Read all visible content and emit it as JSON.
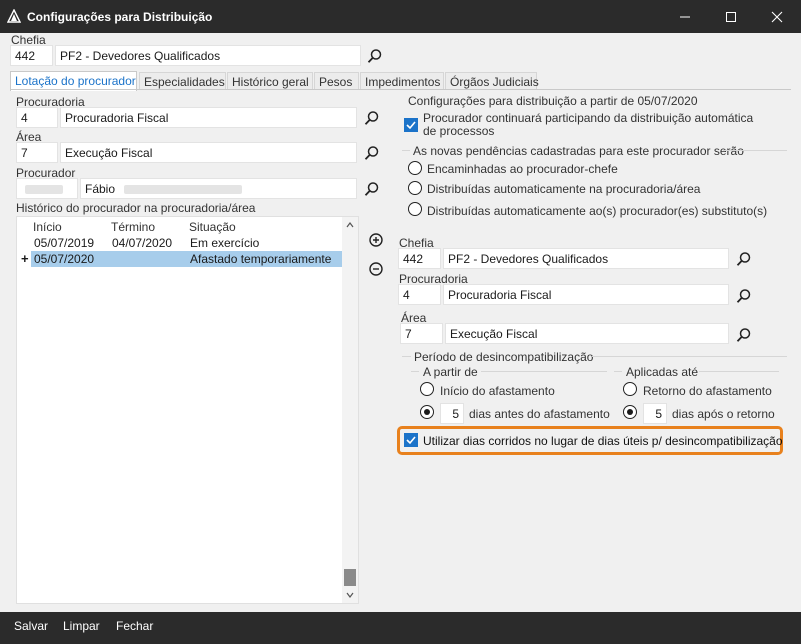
{
  "window": {
    "title": "Configurações para Distribuição",
    "minimize_icon": "minimize-icon",
    "maximize_icon": "maximize-icon",
    "close_icon": "close-icon"
  },
  "top": {
    "chefia_label": "Chefia",
    "chefia_code": "442",
    "chefia_name": "PF2 - Devedores Qualificados"
  },
  "tabs": [
    {
      "label": "Lotação do procurador",
      "active": true
    },
    {
      "label": "Especialidades"
    },
    {
      "label": "Histórico geral"
    },
    {
      "label": "Pesos"
    },
    {
      "label": "Impedimentos"
    },
    {
      "label": "Órgãos Judiciais"
    }
  ],
  "left": {
    "procuradoria_label": "Procuradoria",
    "procuradoria_code": "4",
    "procuradoria_name": "Procuradoria Fiscal",
    "area_label": "Área",
    "area_code": "7",
    "area_name": "Execução Fiscal",
    "procurador_label": "Procurador",
    "procurador_name": "Fábio",
    "historico_label": "Histórico do procurador na procuradoria/área",
    "columns": [
      "Início",
      "Término",
      "Situação"
    ],
    "rows": [
      {
        "inicio": "05/07/2019",
        "termino": "04/07/2020",
        "situacao": "Em exercício"
      },
      {
        "marker": "+",
        "inicio": "05/07/2020",
        "termino": "",
        "situacao": "Afastado temporariamente"
      }
    ]
  },
  "right": {
    "config_title": "Configurações para distribuição a partir de 05/07/2020",
    "continue_label": "Procurador continuará participando da distribuição automática de processos",
    "pendencias_label": "As novas pendências cadastradas para este procurador serão",
    "pend_options": [
      "Encaminhadas ao procurador-chefe",
      "Distribuídas automaticamente na procuradoria/área",
      "Distribuídas automaticamente ao(s) procurador(es) substituto(s)"
    ],
    "chefia_label": "Chefia",
    "chefia_code": "442",
    "chefia_name": "PF2 - Devedores Qualificados",
    "procuradoria_label": "Procuradoria",
    "procuradoria_code": "4",
    "procuradoria_name": "Procuradoria Fiscal",
    "area_label": "Área",
    "area_code": "7",
    "area_name": "Execução Fiscal",
    "periodo_label": "Período de desincompatibilização",
    "apartir_label": "A partir de",
    "apartir_opt1": "Início do afastamento",
    "apartir_days": "5",
    "apartir_opt2": "dias antes do afastamento",
    "aplicadas_label": "Aplicadas até",
    "aplicadas_opt1": "Retorno do afastamento",
    "aplicadas_days": "5",
    "aplicadas_opt2": "dias após o retorno",
    "corridos_label": "Utilizar dias corridos no lugar de dias úteis p/ desincompatibilização"
  },
  "bottom": {
    "salvar": "Salvar",
    "limpar": "Limpar",
    "fechar": "Fechar"
  },
  "colors": {
    "accent": "#1b73c9",
    "highlight": "#e8811d",
    "titlebar": "#2b2b2b"
  }
}
